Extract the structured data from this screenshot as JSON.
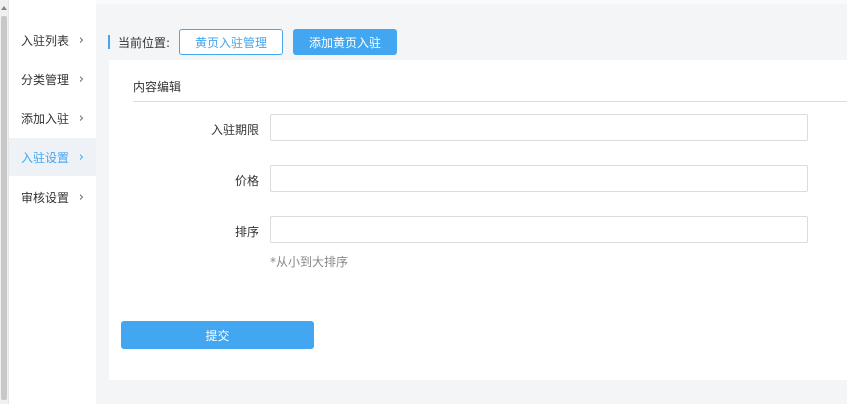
{
  "sidebar": {
    "items": [
      {
        "label": "入驻列表"
      },
      {
        "label": "分类管理"
      },
      {
        "label": "添加入驻"
      },
      {
        "label": "入驻设置"
      },
      {
        "label": "审核设置"
      }
    ],
    "chevron": "›"
  },
  "breadcrumb": {
    "label": "当前位置:",
    "link_label": "黄页入驻管理",
    "current_label": "添加黄页入驻"
  },
  "panel": {
    "title": "内容编辑",
    "fields": {
      "period": {
        "label": "入驻期限",
        "value": ""
      },
      "price": {
        "label": "价格",
        "value": ""
      },
      "sort": {
        "label": "排序",
        "value": "",
        "hint": "*从小到大排序"
      }
    },
    "submit_label": "提交"
  },
  "colors": {
    "accent": "#42a6f0",
    "active_bg": "#eef2f6",
    "page_bg": "#f4f5f7"
  }
}
